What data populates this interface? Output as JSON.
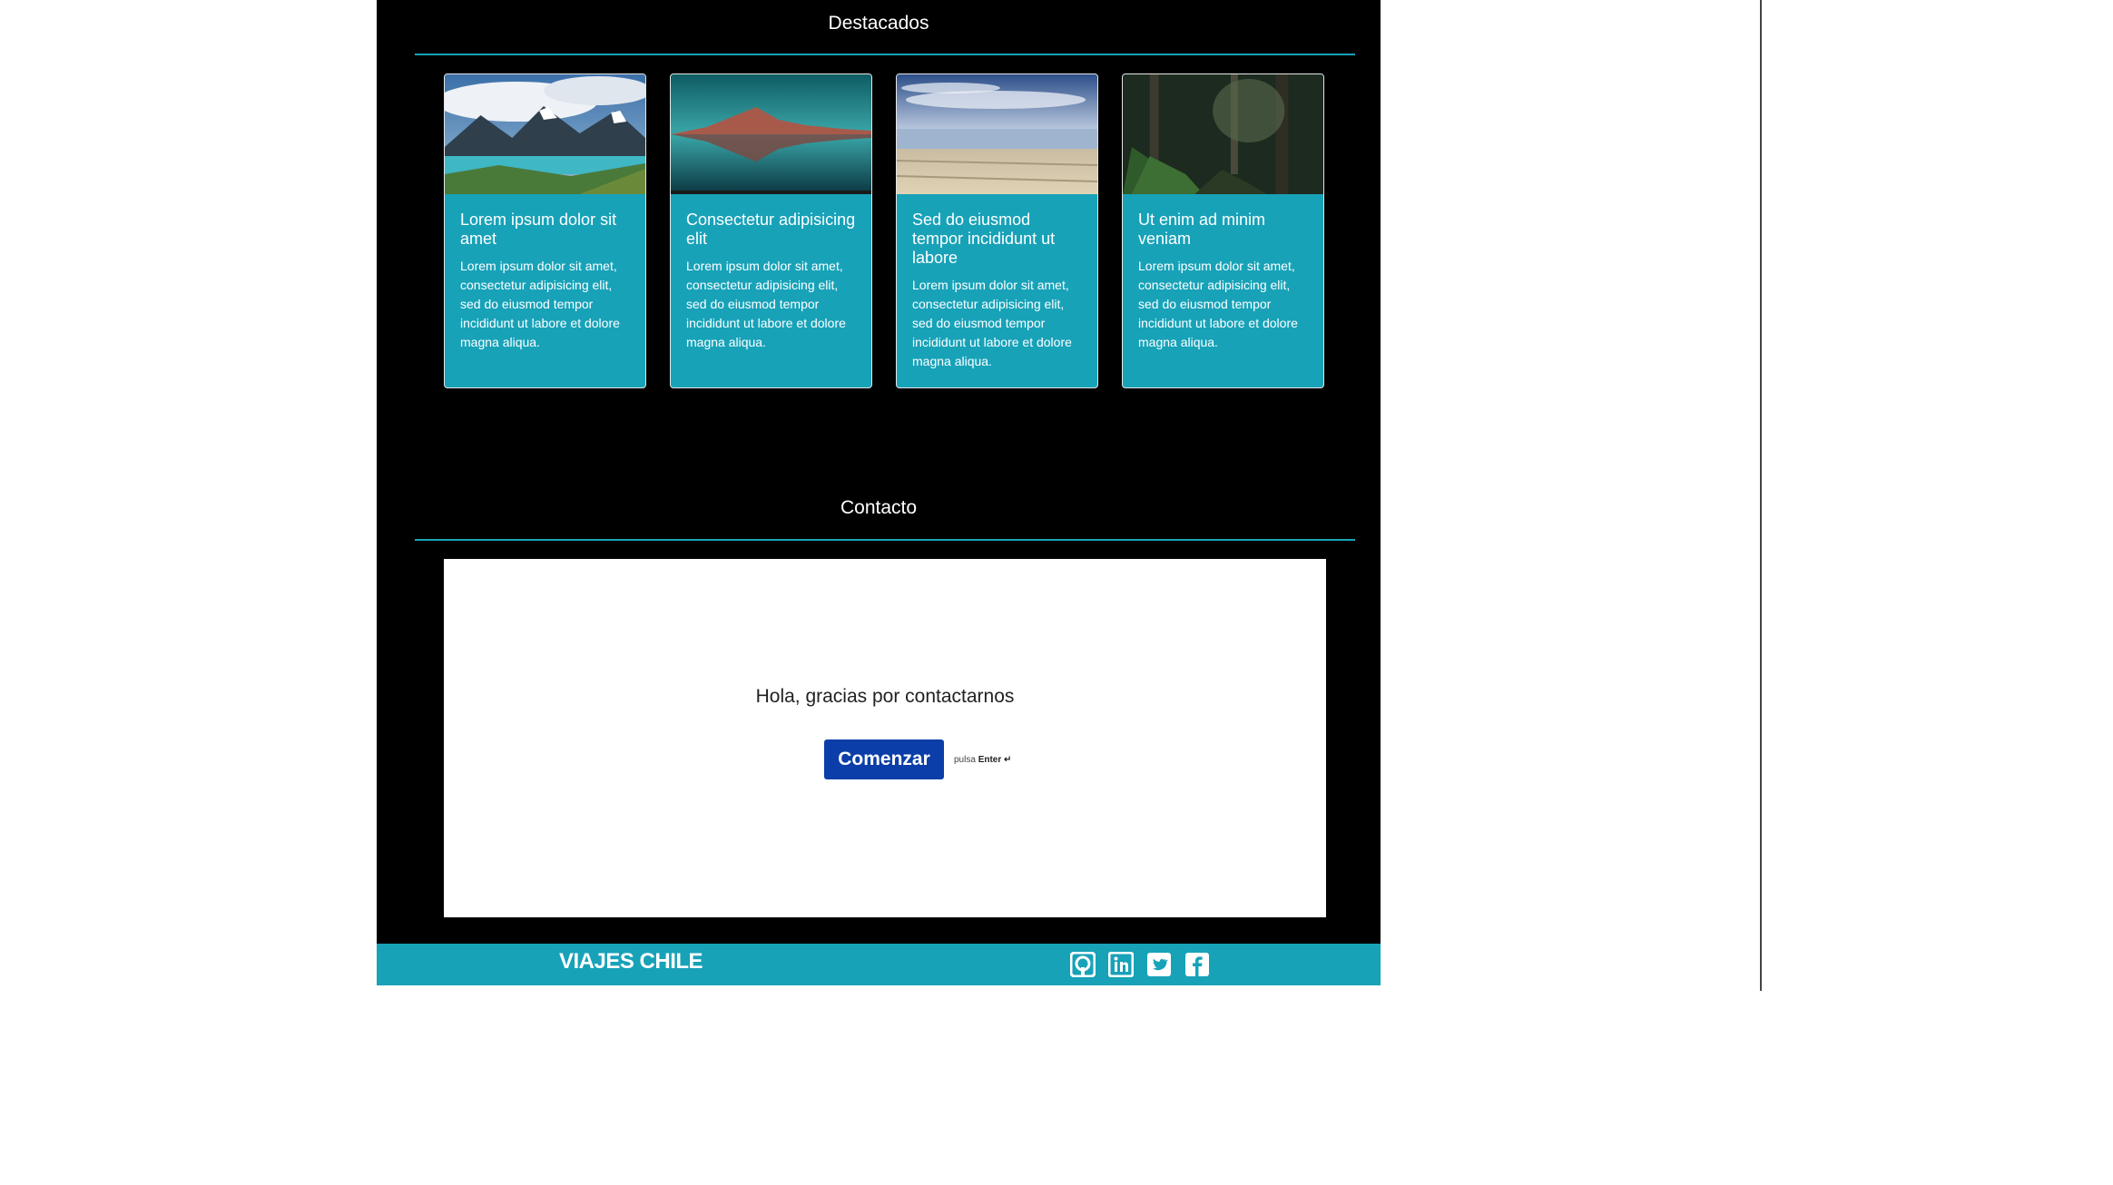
{
  "featured": {
    "title": "Destacados",
    "cards": [
      {
        "title": "Lorem ipsum dolor sit amet",
        "text": "Lorem ipsum dolor sit amet, consectetur adipisicing elit, sed do eiusmod tempor incididunt ut labore et dolore magna aliqua."
      },
      {
        "title": "Consectetur adipisicing elit",
        "text": "Lorem ipsum dolor sit amet, consectetur adipisicing elit, sed do eiusmod tempor incididunt ut labore et dolore magna aliqua."
      },
      {
        "title": "Sed do eiusmod tempor incididunt ut labore",
        "text": "Lorem ipsum dolor sit amet, consectetur adipisicing elit, sed do eiusmod tempor incididunt ut labore et dolore magna aliqua."
      },
      {
        "title": "Ut enim ad minim veniam",
        "text": "Lorem ipsum dolor sit amet, consectetur adipisicing elit, sed do eiusmod tempor incididunt ut labore et dolore magna aliqua."
      }
    ]
  },
  "contact": {
    "title": "Contacto",
    "greeting": "Hola, gracias por contactarnos",
    "start_label": "Comenzar",
    "hint_prefix": "pulsa",
    "hint_key": "Enter ↵"
  },
  "footer": {
    "brand": "VIAJES CHILE",
    "icons": [
      "github-icon",
      "linkedin-icon",
      "twitter-icon",
      "facebook-icon"
    ]
  },
  "colors": {
    "accent": "#17a2b8",
    "button": "#0b3ea8",
    "background": "#000000"
  }
}
